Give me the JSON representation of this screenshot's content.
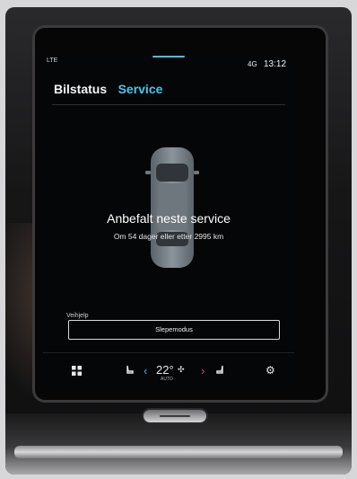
{
  "status_bar": {
    "network": "LTE",
    "signal": "4G",
    "time": "13:12"
  },
  "tabs": [
    {
      "label": "Bilstatus",
      "active": false
    },
    {
      "label": "Service",
      "active": true
    }
  ],
  "service": {
    "title": "Anbefalt neste service",
    "subtitle": "Om 54 dager eller etter 2995 km"
  },
  "assistance": {
    "section_label": "Veihjelp",
    "tow_button_label": "Slepemodus"
  },
  "climate_bar": {
    "temperature": "22°",
    "mode_label": "AUTO",
    "icons": {
      "home": "grid-home-icon",
      "seat_left": "seat-heat-icon",
      "temp_down": "chevron-left-icon",
      "fan": "fan-icon",
      "temp_up": "chevron-right-icon",
      "seat_right": "seat-heat-icon",
      "settings": "gear-icon"
    }
  },
  "colors": {
    "accent_blue": "#49c5ee",
    "temp_down": "#3fa2ee",
    "temp_up": "#e0486a",
    "background": "#050607"
  }
}
